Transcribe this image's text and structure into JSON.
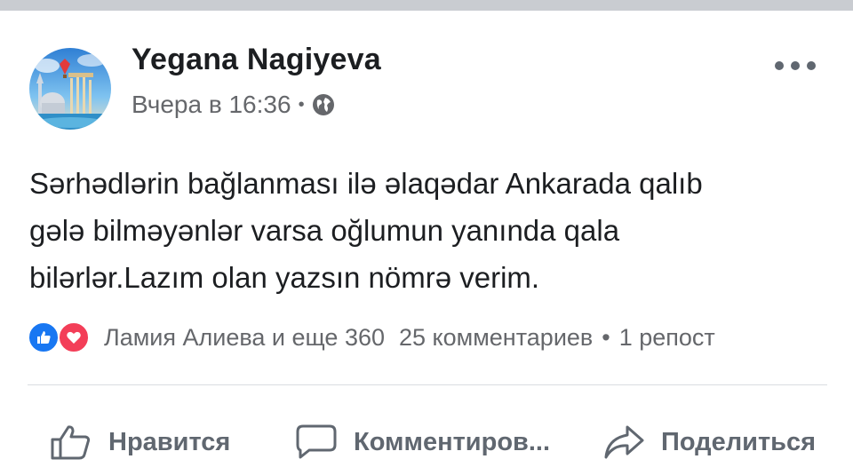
{
  "post": {
    "author": "Yegana Nagiyeva",
    "time": "Вчера в 16:36",
    "separator": "•",
    "privacy_icon": "globe-icon",
    "more_icon": "more-dots-icon",
    "text_lines": [
      "Sərhədlərin bağlanması ilə əlaqədar Ankarada qalıb",
      "gələ bilməyənlər varsa oğlumun yanında qala",
      "bilərlər.Lazım olan yazsın nömrə verim."
    ]
  },
  "reactions": {
    "icons": [
      "like-reaction-icon",
      "love-reaction-icon"
    ],
    "names": "Ламия Алиева и еще 360",
    "comments": "25 комментариев",
    "separator": "•",
    "shares": "1 репост"
  },
  "actions": {
    "like_label": "Нравится",
    "comment_label": "Комментиров...",
    "share_label": "Поделиться"
  },
  "colors": {
    "like_blue": "#1877f2",
    "love_red": "#f33e58",
    "secondary_text": "#65676b"
  }
}
